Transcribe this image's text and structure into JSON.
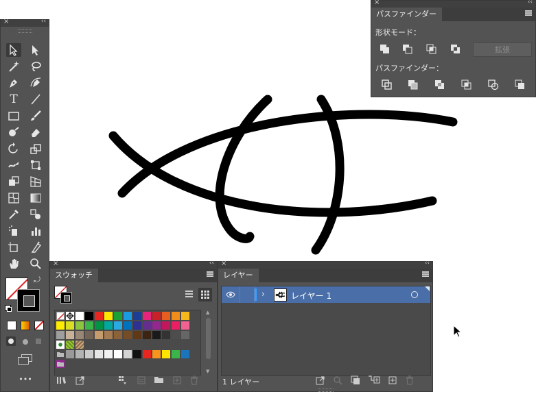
{
  "tools_panel": {
    "more_label": "•••"
  },
  "pathfinder": {
    "tab": "パスファインダー",
    "shape_modes_label": "形状モード：",
    "expand_button": "拡張",
    "pathfinders_label": "パスファインダー："
  },
  "swatches": {
    "tab": "スウォッチ",
    "colors": [
      "#ffffff",
      "#000000",
      "#e6261f",
      "#ffe600",
      "#1aa035",
      "#1b9be0",
      "#1c3f95",
      "#e5247b",
      "#ca2027",
      "#e85e20",
      "#f08c1c",
      "#f5b81c",
      "#ffed00",
      "#d9e021",
      "#8cc63f",
      "#39b54a",
      "#009245",
      "#00a99d",
      "#29abe2",
      "#0071bc",
      "#2e3192",
      "#662d91",
      "#93278f",
      "#c2185b",
      "#e91e63",
      "#f06292",
      "#9e9e9e",
      "#c7b299",
      "#998675",
      "#736357",
      "#c69c6d",
      "#a67c52",
      "#8c6239",
      "#754c24",
      "#603813",
      "#3c2415",
      "#1a1a1a",
      "#333333",
      "#4d4d4d",
      "#666666",
      "#808080",
      "#999999",
      "#b3b3b3",
      "#cccccc",
      "#e6e6e6",
      "#f2f2f2",
      "#ffffff",
      "#d4d4d4",
      "#111111",
      "#e6261f",
      "#f7941d",
      "#ffe600",
      "#39b54a",
      "#1b75bc",
      "#92278f"
    ]
  },
  "layers": {
    "tab": "レイヤー",
    "layer_name": "レイヤー 1",
    "footer_count": "1 レイヤー",
    "accent": "#4a6ea8"
  },
  "canvas": {
    "stroke_color": "#000000"
  }
}
